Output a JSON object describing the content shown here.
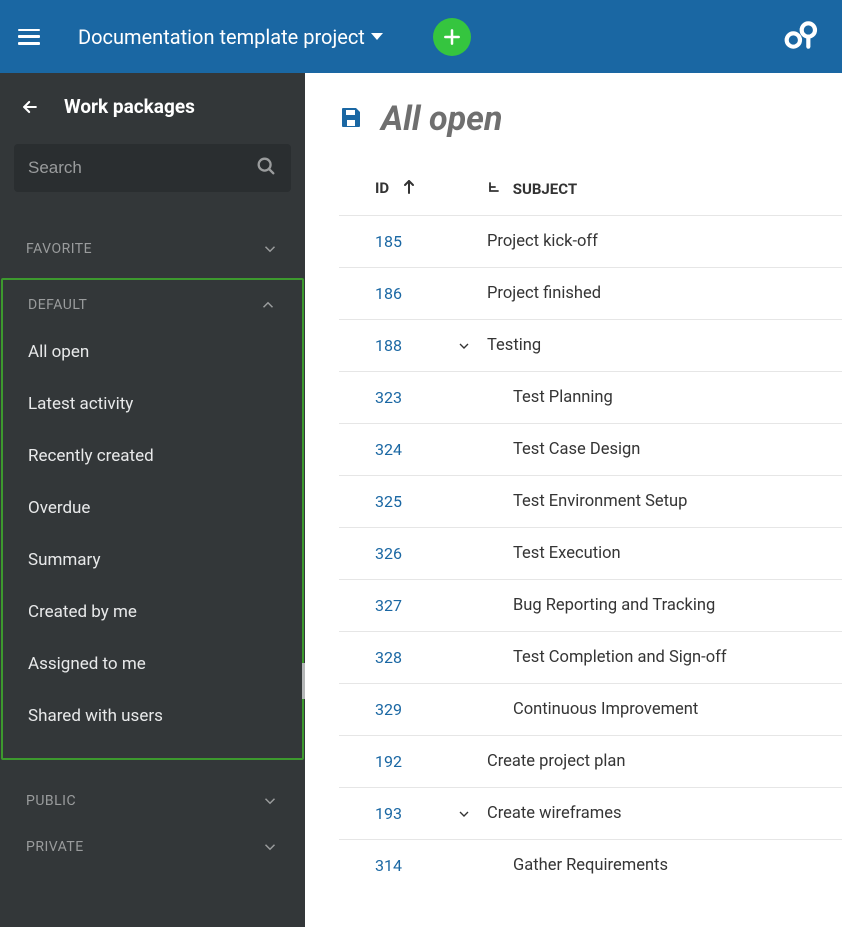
{
  "topbar": {
    "project_name": "Documentation template project"
  },
  "sidebar": {
    "title": "Work packages",
    "search_placeholder": "Search",
    "sections": {
      "favorite": {
        "label": "FAVORITE",
        "expanded": false
      },
      "default": {
        "label": "DEFAULT",
        "expanded": true
      },
      "public": {
        "label": "PUBLIC",
        "expanded": false
      },
      "private": {
        "label": "PRIVATE",
        "expanded": false
      }
    },
    "default_items": [
      "All open",
      "Latest activity",
      "Recently created",
      "Overdue",
      "Summary",
      "Created by me",
      "Assigned to me",
      "Shared with users"
    ]
  },
  "main": {
    "title": "All open",
    "columns": {
      "id": "ID",
      "subject": "SUBJECT"
    },
    "rows": [
      {
        "id": "185",
        "subject": "Project kick-off",
        "indent": 0,
        "expander": false
      },
      {
        "id": "186",
        "subject": "Project finished",
        "indent": 0,
        "expander": false
      },
      {
        "id": "188",
        "subject": "Testing",
        "indent": 0,
        "expander": true
      },
      {
        "id": "323",
        "subject": "Test Planning",
        "indent": 1,
        "expander": false
      },
      {
        "id": "324",
        "subject": "Test Case Design",
        "indent": 1,
        "expander": false
      },
      {
        "id": "325",
        "subject": "Test Environment Setup",
        "indent": 1,
        "expander": false
      },
      {
        "id": "326",
        "subject": "Test Execution",
        "indent": 1,
        "expander": false
      },
      {
        "id": "327",
        "subject": "Bug Reporting and Tracking",
        "indent": 1,
        "expander": false
      },
      {
        "id": "328",
        "subject": "Test Completion and Sign-off",
        "indent": 1,
        "expander": false
      },
      {
        "id": "329",
        "subject": "Continuous Improvement",
        "indent": 1,
        "expander": false
      },
      {
        "id": "192",
        "subject": "Create project plan",
        "indent": 0,
        "expander": false
      },
      {
        "id": "193",
        "subject": "Create wireframes",
        "indent": 0,
        "expander": true
      },
      {
        "id": "314",
        "subject": "Gather Requirements",
        "indent": 1,
        "expander": false
      }
    ]
  }
}
